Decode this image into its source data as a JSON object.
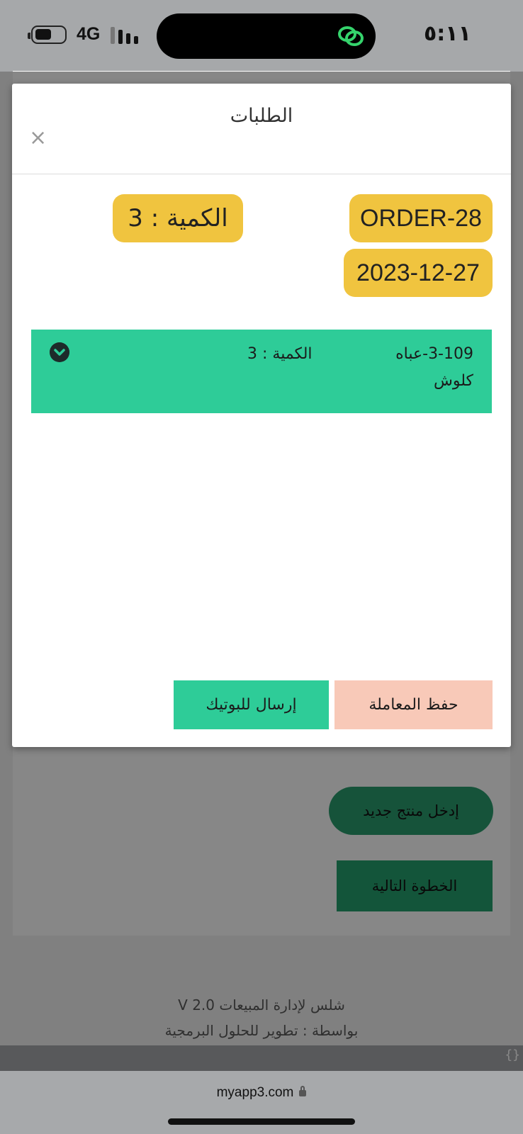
{
  "status_bar": {
    "time": "٥:١١",
    "network": "4G"
  },
  "background_page": {
    "new_product_button": "إدخل منتج جديد",
    "next_step_button": "الخطوة التالية",
    "footer_line1": "شلس لإدارة المبيعات V 2.0",
    "footer_line2": "بواسطة : تطوير للحلول البرمجية",
    "braces": "{}"
  },
  "modal": {
    "title": "الطلبات",
    "close_label": "×",
    "order_id": "ORDER-28",
    "order_date": "2023-12-27",
    "quantity_badge": "الكمية : 3",
    "item": {
      "code": "3-109-عباه",
      "name": "كلوش",
      "quantity": "الكمية : 3"
    },
    "save_button": "حفظ المعاملة",
    "send_button": "إرسال للبوتيك"
  },
  "browser": {
    "url": "myapp3.com"
  },
  "colors": {
    "badge_yellow": "#f0c43f",
    "item_green": "#2ecc98",
    "save_pink": "#f8c9b8",
    "new_btn_green": "#2a9d6e"
  }
}
